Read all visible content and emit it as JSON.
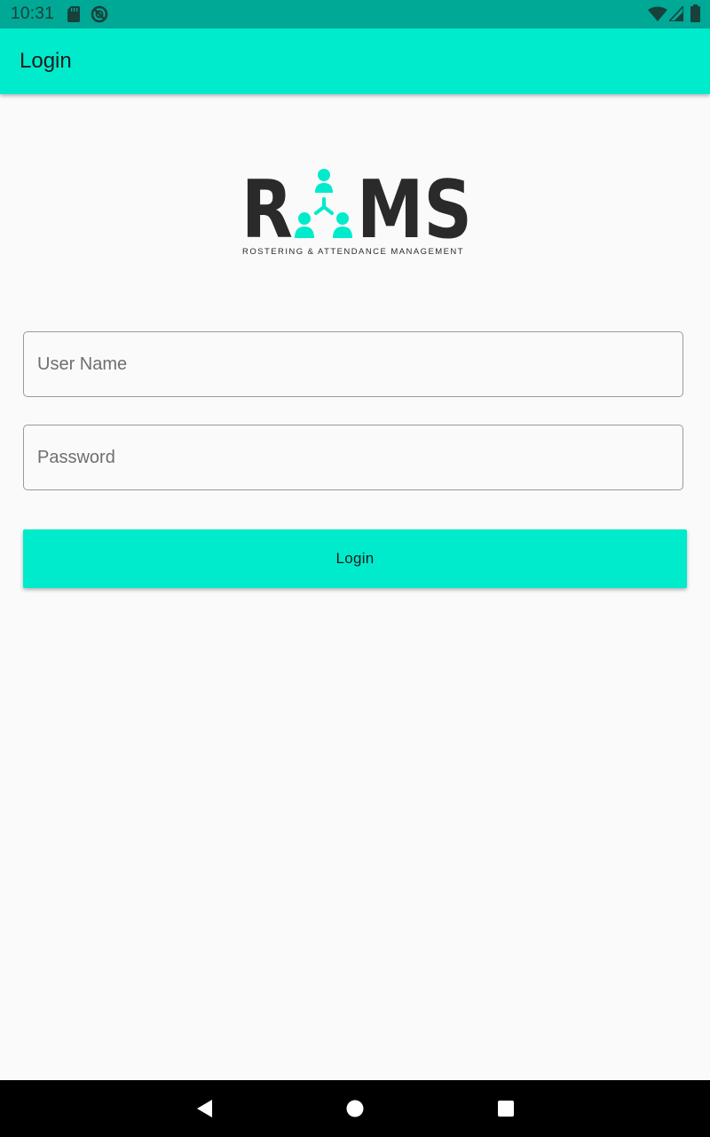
{
  "status_bar": {
    "time": "10:31",
    "left_icons": [
      "sd-card-icon",
      "sync-disabled-icon"
    ],
    "right_icons": [
      "wifi-icon",
      "cellular-signal-icon",
      "battery-icon"
    ]
  },
  "app_bar": {
    "title": "Login"
  },
  "logo": {
    "word_left": "R",
    "word_right": "MS",
    "tagline": "ROSTERING & ATTENDANCE MANAGEMENT",
    "icon": "people-network-icon"
  },
  "form": {
    "username": {
      "placeholder": "User Name",
      "value": ""
    },
    "password": {
      "placeholder": "Password",
      "value": ""
    },
    "login_button": "Login"
  },
  "nav_bar": {
    "buttons": [
      "back-icon",
      "home-icon",
      "recents-icon"
    ]
  },
  "colors": {
    "status_bar": "#00a896",
    "accent": "#00ebcc",
    "background": "#fafafa",
    "logo_text": "#2a2a2a",
    "nav_bar": "#000000"
  }
}
